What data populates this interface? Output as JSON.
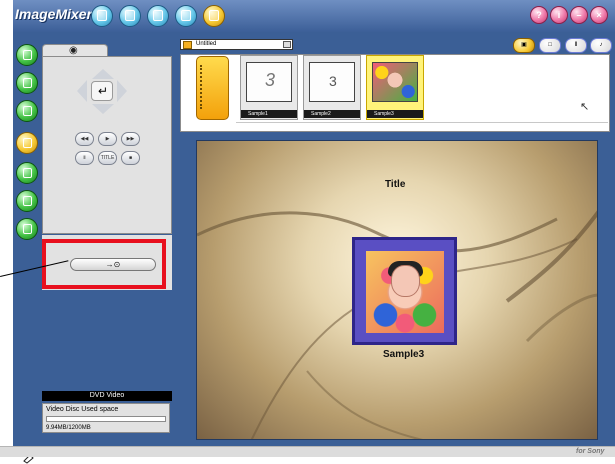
{
  "app": {
    "title": "ImageMixer",
    "brand": "for Sony",
    "mode_icons": [
      "capture-icon",
      "album-icon",
      "edit-icon",
      "video-icon",
      "dvd-icon"
    ],
    "window_icons": [
      "help-icon",
      "info-icon",
      "minimize-icon",
      "close-icon"
    ]
  },
  "left_nav": {
    "items": [
      "nav-1-icon",
      "nav-2-icon",
      "nav-3-icon",
      "nav-4-icon",
      "nav-5-icon",
      "nav-6-icon",
      "nav-7-icon"
    ],
    "active_item": "nav-4-icon"
  },
  "controls": {
    "tab_icon": "eye-icon",
    "transport": [
      "prev",
      "play",
      "next",
      "pause",
      "TITLE",
      "stop"
    ],
    "action_button_label": "→⊙"
  },
  "disc": {
    "label": "DVD Video",
    "header": "Video Disc   Used space",
    "usage": "9.94MB/1200MB"
  },
  "project": {
    "name": "Untitled",
    "view_buttons": [
      "view-1",
      "view-2",
      "view-3",
      "view-4"
    ]
  },
  "thumbnails": [
    {
      "label": "Sample1",
      "glyph": "3"
    },
    {
      "label": "Sample2",
      "glyph": "3"
    },
    {
      "label": "Sample3",
      "glyph": ""
    }
  ],
  "preview": {
    "title": "Title",
    "item_label": "Sample3"
  },
  "colors": {
    "window_blue": "#3b5f96",
    "callout_red": "#e8101e",
    "menu_purple": "#5a4fc3"
  }
}
